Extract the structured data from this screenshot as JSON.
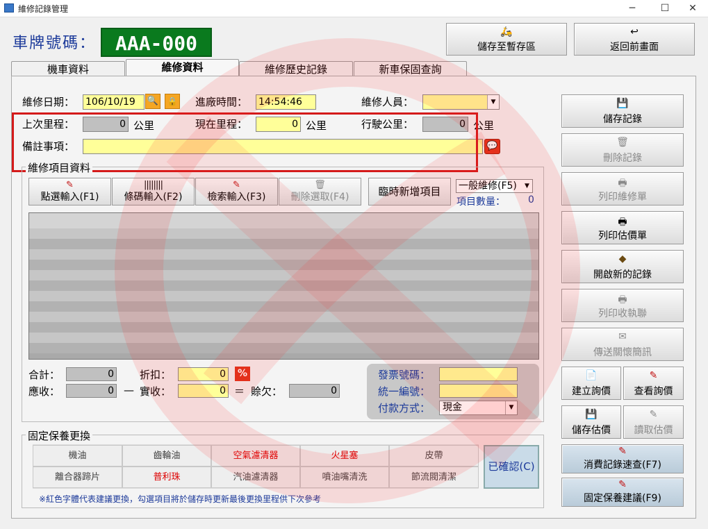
{
  "window": {
    "title": "維修記錄管理",
    "min": "─",
    "max": "☐",
    "close": "✕"
  },
  "header": {
    "plate_label": "車牌號碼：",
    "plate_value": "AAA-000",
    "save_temp": "儲存至暫存區",
    "back": "返回前畫面"
  },
  "tabs": [
    "機車資料",
    "維修資料",
    "維修歷史記錄",
    "新車保固查詢"
  ],
  "form": {
    "date_label": "維修日期：",
    "date_value": "106/10/19",
    "time_label": "進廠時間：",
    "time_value": "14:54:46",
    "staff_label": "維修人員：",
    "staff_value": "",
    "last_mileage_label": "上次里程：",
    "last_mileage_value": "0",
    "unit": "公里",
    "current_mileage_label": "現在里程：",
    "current_mileage_value": "0",
    "driven_label": "行駛公里：",
    "driven_value": "0",
    "note_label": "備註事項：",
    "note_value": ""
  },
  "items": {
    "title": "維修項目資料",
    "buttons": [
      "點選輸入(F1)",
      "條碼輸入(F2)",
      "檢索輸入(F3)",
      "刪除選取(F4)"
    ],
    "temp_add": "臨時新增項目",
    "type_value": "一般維修(F5)",
    "count_label": "項目數量：",
    "count_value": "0"
  },
  "totals": {
    "sum_label": "合計：",
    "sum_value": "0",
    "discount_label": "折扣：",
    "discount_value": "0",
    "pct": "%",
    "receivable_label": "應收：",
    "receivable_value": "0",
    "minus": "—",
    "paid_label": "實收：",
    "paid_value": "0",
    "equals": "＝",
    "owed_label": "賒欠：",
    "owed_value": "0"
  },
  "invoice": {
    "invoice_label": "發票號碼：",
    "tax_label": "統一編號：",
    "payment_label": "付款方式：",
    "payment_value": "現金",
    "invoice_value": "",
    "tax_value": ""
  },
  "maintenance": {
    "title": "固定保養更換",
    "row1": [
      "機油",
      "齒輪油",
      "空氣濾清器",
      "火星塞",
      "皮帶"
    ],
    "row2": [
      "離合器蹄片",
      "普利珠",
      "汽油濾清器",
      "噴油嘴清洗",
      "節流閥清潔"
    ],
    "red_items": [
      "空氣濾清器",
      "火星塞",
      "普利珠"
    ],
    "confirm": "已確認(C)",
    "note": "※紅色字體代表建議更換，勾選項目將於儲存時更新最後更換里程供下次參考"
  },
  "side": {
    "save": "儲存記錄",
    "delete": "刪除記錄",
    "print_repair": "列印維修單",
    "print_quote": "列印估價單",
    "new": "開啟新的記錄",
    "print_receipt": "列印收執聯",
    "send_msg": "傳送關懷簡訊",
    "create_inquiry": "建立詢價",
    "view_inquiry": "查看詢價",
    "save_quote": "儲存估價",
    "load_quote": "讀取估價",
    "history": "消費記錄速查(F7)",
    "suggest": "固定保養建議(F9)"
  },
  "colors": {
    "accent": "#1c3a9a",
    "plate_bg": "#0a7a1e",
    "input": "#ffff99",
    "highlight_frame": "#d41a1a"
  }
}
